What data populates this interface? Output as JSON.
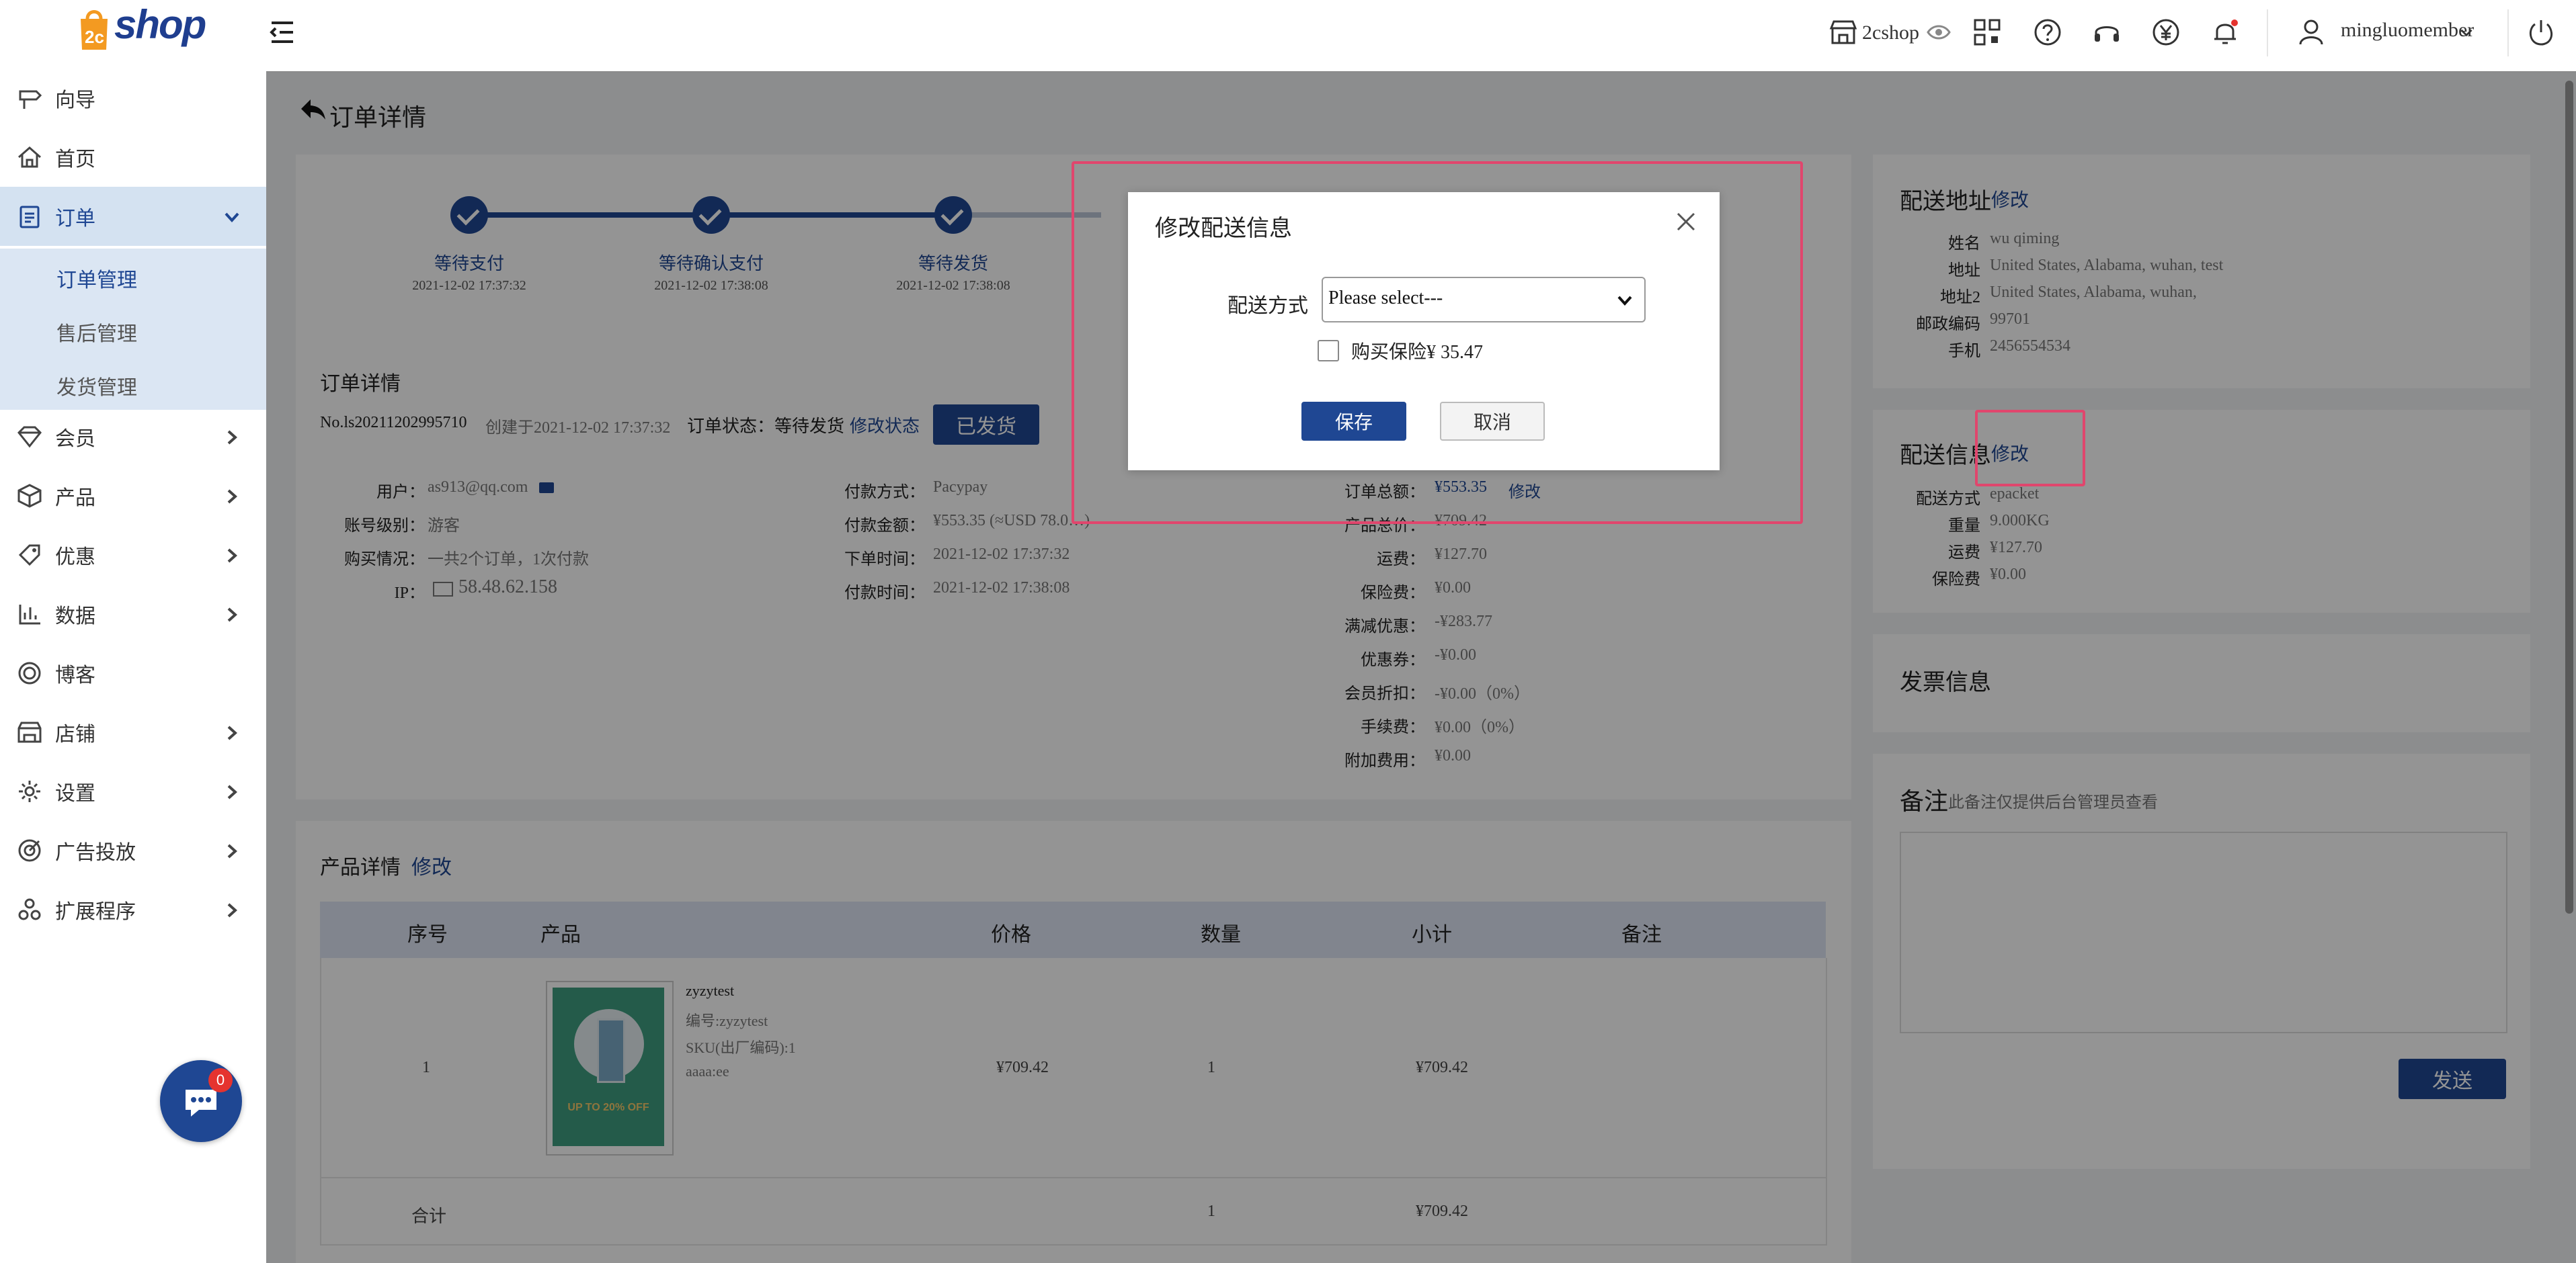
{
  "header": {
    "logo_text": "shop",
    "store_name": "2cshop",
    "user_name": "mingluomember",
    "icons": [
      "store-icon",
      "eye-icon",
      "qrcode-icon",
      "help-icon",
      "headset-icon",
      "yen-icon",
      "bell-icon",
      "user-icon",
      "power-icon"
    ]
  },
  "sidebar": {
    "items": [
      {
        "label": "向导"
      },
      {
        "label": "首页"
      },
      {
        "label": "订单"
      },
      {
        "label": "会员"
      },
      {
        "label": "产品"
      },
      {
        "label": "优惠"
      },
      {
        "label": "数据"
      },
      {
        "label": "博客"
      },
      {
        "label": "店铺"
      },
      {
        "label": "设置"
      },
      {
        "label": "广告投放"
      },
      {
        "label": "扩展程序"
      }
    ],
    "submenu": [
      {
        "label": "订单管理"
      },
      {
        "label": "售后管理"
      },
      {
        "label": "发货管理"
      }
    ],
    "chat_badge": "0"
  },
  "page": {
    "title": "订单详情",
    "steps": [
      {
        "title": "等待支付",
        "time": "2021-12-02 17:37:32"
      },
      {
        "title": "等待确认支付",
        "time": "2021-12-02 17:38:08"
      },
      {
        "title": "等待发货",
        "time": "2021-12-02 17:38:08"
      }
    ],
    "order": {
      "section_title": "订单详情",
      "number": "No.ls20211202995710",
      "created": "创建于2021-12-02 17:37:32",
      "status_label": "订单状态：等待发货",
      "modify_status": "修改状态",
      "shipped_button": "已发货",
      "left": [
        {
          "label": "用户：",
          "value": "as913@qq.com"
        },
        {
          "label": "账号级别：",
          "value": "游客"
        },
        {
          "label": "购买情况：",
          "value": "一共2个订单，1次付款"
        },
        {
          "label": "IP：",
          "value": "58.48.62.158"
        }
      ],
      "middle": [
        {
          "label": "付款方式：",
          "value": "Pacypay"
        },
        {
          "label": "付款金额：",
          "value": "¥553.35 (≈USD 78.0…)"
        },
        {
          "label": "下单时间：",
          "value": "2021-12-02 17:37:32"
        },
        {
          "label": "付款时间：",
          "value": "2021-12-02 17:38:08"
        }
      ],
      "total_label": "订单总额：",
      "total_value": "¥553.35",
      "total_modify": "修改",
      "right": [
        {
          "label": "产品总价：",
          "value": "¥709.42"
        },
        {
          "label": "运费：",
          "value": "¥127.70"
        },
        {
          "label": "保险费：",
          "value": "¥0.00"
        },
        {
          "label": "满减优惠：",
          "value": "-¥283.77"
        },
        {
          "label": "优惠券：",
          "value": "-¥0.00"
        },
        {
          "label": "会员折扣：",
          "value": "-¥0.00（0%）"
        },
        {
          "label": "手续费：",
          "value": "¥0.00（0%）"
        },
        {
          "label": "附加费用：",
          "value": "¥0.00"
        }
      ]
    },
    "products": {
      "title": "产品详情",
      "modify": "修改",
      "columns": [
        "序号",
        "产品",
        "价格",
        "数量",
        "小计",
        "备注"
      ],
      "rows": [
        {
          "index": "1",
          "name": "zyzytest",
          "code": "编号:zyzytest",
          "sku": "SKU(出厂编码):1",
          "attr": "aaaa:ee",
          "price": "¥709.42",
          "qty": "1",
          "subtotal": "¥709.42",
          "note": ""
        }
      ],
      "image_caption": "UP TO 20% OFF",
      "total_label": "合计",
      "total_qty": "1",
      "total_subtotal": "¥709.42"
    },
    "address": {
      "title": "配送地址",
      "modify": "修改",
      "fields": [
        {
          "label": "姓名",
          "value": "wu qiming"
        },
        {
          "label": "地址",
          "value": "United States, Alabama, wuhan, test"
        },
        {
          "label": "地址2",
          "value": "United States, Alabama, wuhan,"
        },
        {
          "label": "邮政编码",
          "value": "99701"
        },
        {
          "label": "手机",
          "value": "2456554534"
        }
      ]
    },
    "shipping": {
      "title": "配送信息",
      "modify": "修改",
      "fields": [
        {
          "label": "配送方式",
          "value": "epacket"
        },
        {
          "label": "重量",
          "value": "9.000KG"
        },
        {
          "label": "运费",
          "value": "¥127.70"
        },
        {
          "label": "保险费",
          "value": "¥0.00"
        }
      ]
    },
    "invoice": {
      "title": "发票信息"
    },
    "remark": {
      "title": "备注",
      "hint": "此备注仅提供后台管理员查看",
      "send": "发送"
    }
  },
  "dialog": {
    "title": "修改配送信息",
    "method_label": "配送方式",
    "select_value": "Please select---",
    "insurance_label": "购买保险¥ 35.47",
    "save": "保存",
    "cancel": "取消"
  },
  "colors": {
    "brand": "#1f4793",
    "highlight": "#e0466d",
    "logo_orange": "#f39a21"
  }
}
